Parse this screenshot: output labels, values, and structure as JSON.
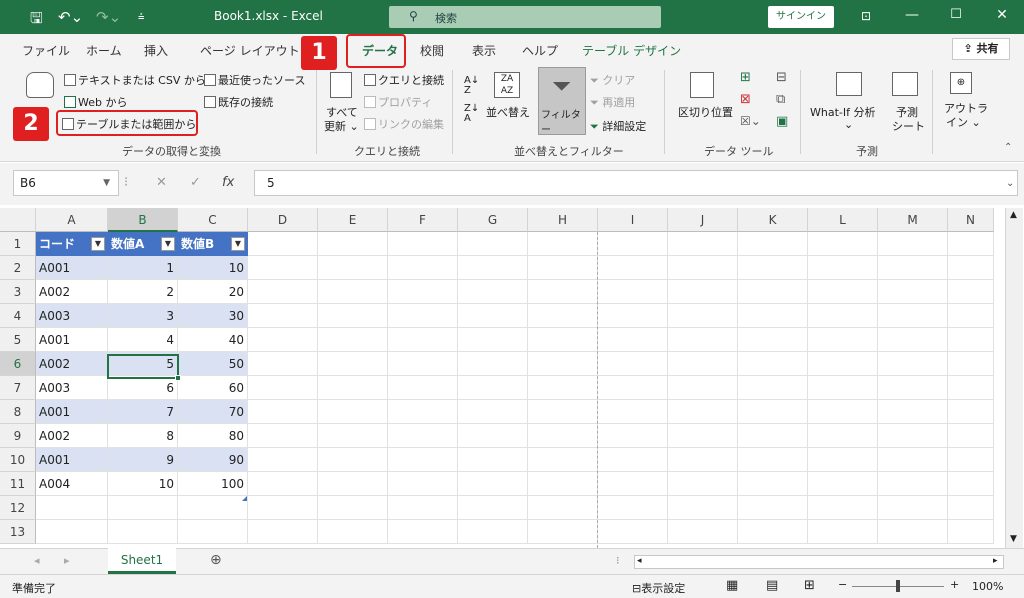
{
  "title": {
    "save_icon": "save-icon",
    "undo_icon": "undo-icon",
    "filename": "Book1.xlsx  -  Excel",
    "search_placeholder": "検索",
    "signin": "サインイン",
    "accent": "#217346"
  },
  "tabs": [
    "ファイル",
    "ホーム",
    "挿入",
    "ページ レイアウト",
    "データ",
    "校閲",
    "表示",
    "ヘルプ",
    "テーブル デザイン"
  ],
  "share_label": "共有",
  "ribbon": {
    "get_data": {
      "from_text_csv": "テキストまたは CSV から",
      "from_web": "Web から",
      "from_table": "テーブルまたは範囲から",
      "recent_sources": "最近使ったソース",
      "existing_connections": "既存の接続",
      "group_label": "データの取得と変換"
    },
    "queries": {
      "refresh_all_1": "すべて",
      "refresh_all_2": "更新 ⌄",
      "queries_connections": "クエリと接続",
      "properties": "プロパティ",
      "edit_links": "リンクの編集",
      "group_label": "クエリと接続"
    },
    "sort_filter": {
      "sort": "並べ替え",
      "filter": "フィルター",
      "clear": "クリア",
      "reapply": "再適用",
      "advanced": "詳細設定",
      "group_label": "並べ替えとフィルター"
    },
    "data_tools": {
      "text_to_columns": "区切り位置",
      "group_label": "データ ツール"
    },
    "forecast": {
      "what_if": "What-If 分析",
      "forecast_sheet_1": "予測",
      "forecast_sheet_2": "シート",
      "group_label": "予測"
    },
    "outline": {
      "outline_1": "アウトラ",
      "outline_2": "イン ⌄"
    }
  },
  "callouts": [
    "1",
    "2"
  ],
  "formula_bar": {
    "name_box": "B6",
    "formula": "5",
    "fx": "fx"
  },
  "columns": [
    "A",
    "B",
    "C",
    "D",
    "E",
    "F",
    "G",
    "H",
    "I",
    "J",
    "K",
    "L",
    "M",
    "N"
  ],
  "rows": [
    "1",
    "2",
    "3",
    "4",
    "5",
    "6",
    "7",
    "8",
    "9",
    "10",
    "11",
    "12",
    "13"
  ],
  "table": {
    "headers": [
      "コード",
      "数値A",
      "数値B"
    ],
    "rows": [
      [
        "A001",
        "1",
        "10"
      ],
      [
        "A002",
        "2",
        "20"
      ],
      [
        "A003",
        "3",
        "30"
      ],
      [
        "A001",
        "4",
        "40"
      ],
      [
        "A002",
        "5",
        "50"
      ],
      [
        "A003",
        "6",
        "60"
      ],
      [
        "A001",
        "7",
        "70"
      ],
      [
        "A002",
        "8",
        "80"
      ],
      [
        "A001",
        "9",
        "90"
      ],
      [
        "A004",
        "10",
        "100"
      ]
    ]
  },
  "sheet_tab": "Sheet1",
  "status": {
    "ready": "準備完了",
    "display_settings": "表示設定",
    "zoom": "100%"
  }
}
